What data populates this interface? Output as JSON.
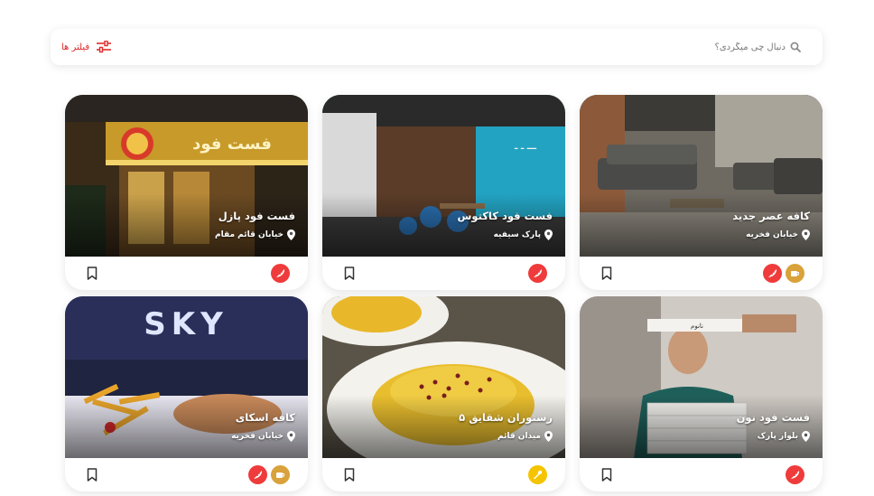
{
  "search": {
    "placeholder": "دنبال چی میگردی؟"
  },
  "filters": {
    "label": "فیلتر ها"
  },
  "colors": {
    "accent": "#e02b2b",
    "fastfood_badge": "#ef3b3b",
    "cafe_badge": "#d9a23a",
    "restaurant_badge": "#f5c400"
  },
  "cards": [
    {
      "title": "کافه عصر جدید",
      "location": "خیابان فخریه",
      "badges": [
        "fastfood-icon",
        "cafe-icon"
      ]
    },
    {
      "title": "فست فود کاکتوس",
      "location": "پارک سیفیه",
      "badges": [
        "fastfood-icon"
      ]
    },
    {
      "title": "فست فود پازل",
      "location": "خیابان قائم مقام",
      "badges": [
        "fastfood-icon"
      ],
      "sign_text": "فست فود"
    },
    {
      "title": "فست فود نون",
      "location": "بلوار پارک",
      "badges": [
        "fastfood-icon"
      ],
      "box_text": "نانوم"
    },
    {
      "title": "رستوران شقایق ۵",
      "location": "میدان قائم",
      "badges": [
        "restaurant-icon"
      ]
    },
    {
      "title": "کافه اسکای",
      "location": "خیابان فخریه",
      "badges": [
        "cafe-icon",
        "fastfood-icon"
      ],
      "sign_text": "SKY"
    }
  ]
}
